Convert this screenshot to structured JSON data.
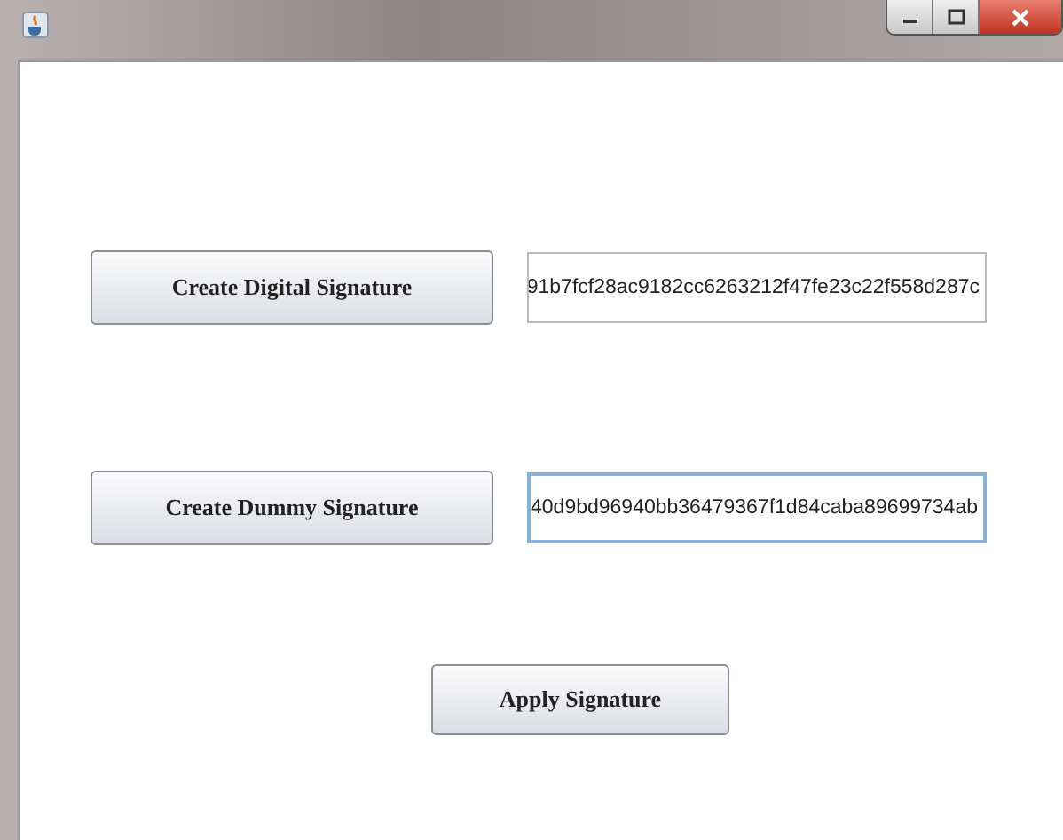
{
  "rows": [
    {
      "button": "Create Digital Signature",
      "value": "91b7fcf28ac9182cc6263212f47fe23c22f558d287c",
      "focused": false
    },
    {
      "button": "Create Dummy Signature",
      "value": "40d9bd96940bb36479367f1d84caba89699734ab",
      "focused": true
    }
  ],
  "apply_button": "Apply Signature"
}
